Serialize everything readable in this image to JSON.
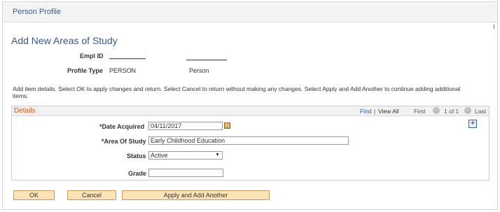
{
  "header": {
    "title": "Person Profile"
  },
  "page": {
    "title": "Add New Areas of Study",
    "empl_id_label": "Empl ID",
    "profile_type_label": "Profile Type",
    "profile_type_value": "PERSON",
    "profile_type_desc": "Person",
    "instructions": "Add item details. Select OK to apply changes and return. Select Cancel to return without making any changes. Select Apply and Add Another to continue adding additional items."
  },
  "details": {
    "title": "Details",
    "find": "Find",
    "separator": "|",
    "view_all": "View All",
    "first": "First",
    "range": "1 of 1",
    "last": "Last",
    "prev_icon": "‹",
    "next_icon": "›",
    "add_icon": "+"
  },
  "form": {
    "date_label": "*Date Acquired",
    "date_value": "04/11/2017",
    "area_label": "*Area Of Study",
    "area_value": "Early Childhood Education",
    "status_label": "Status",
    "status_value": "Active",
    "grade_label": "Grade",
    "grade_value": ""
  },
  "buttons": {
    "ok": "OK",
    "cancel": "Cancel",
    "apply_add": "Apply and Add Another"
  },
  "colors": {
    "header_text": "#3b5a86",
    "details_title": "#c45a1a",
    "button_bg": "#fde3b8",
    "link": "#2a5aa8"
  }
}
